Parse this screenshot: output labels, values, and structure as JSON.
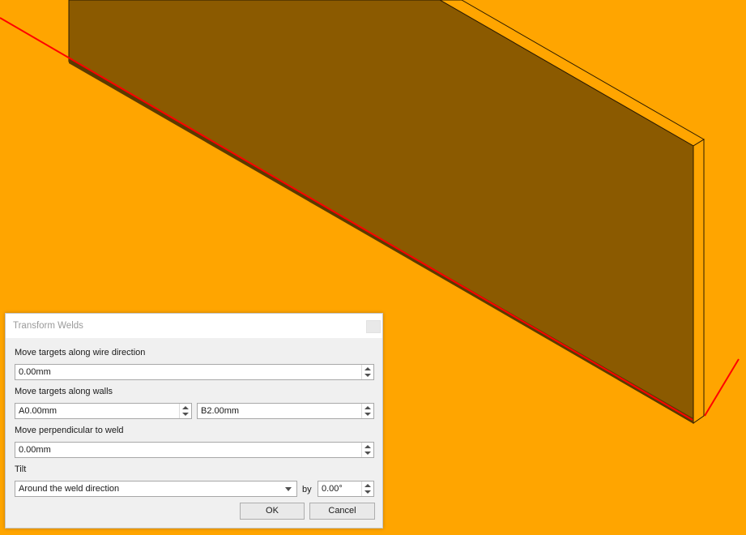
{
  "dialog": {
    "title": "Transform Welds",
    "wire_direction": {
      "label": "Move targets along wire direction",
      "value": "0.00mm"
    },
    "walls": {
      "label": "Move targets along walls",
      "value_a": "A0.00mm",
      "value_b": "B2.00mm"
    },
    "perpendicular": {
      "label": "Move perpendicular to weld",
      "value": "0.00mm"
    },
    "tilt": {
      "label": "Tilt",
      "mode": "Around the weld direction",
      "by_label": "by",
      "angle": "0.00°"
    },
    "ok_label": "OK",
    "cancel_label": "Cancel"
  },
  "scene": {
    "background": "#FFA500",
    "plate_color": "#8B5A00",
    "weld_line_color": "#FF0000"
  }
}
